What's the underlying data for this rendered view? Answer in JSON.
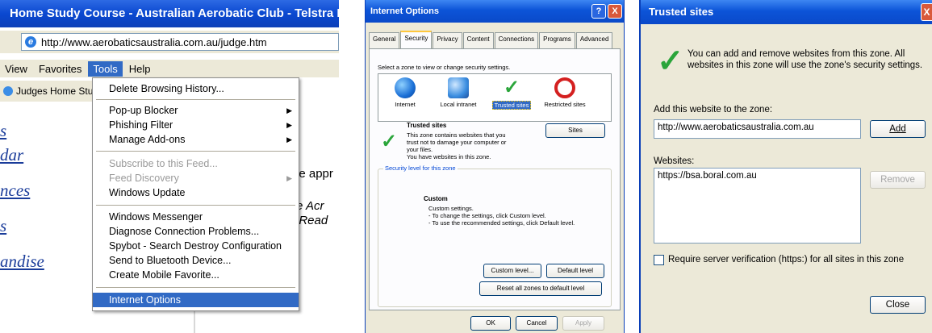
{
  "browser": {
    "title": "Home Study Course - Australian Aerobatic Club - Telstra BigP",
    "address": "http://www.aerobaticsaustralia.com.au/judge.htm",
    "menubar": [
      "View",
      "Favorites",
      "Tools",
      "Help"
    ],
    "active_menu": "Tools",
    "links_bar_item": "Judges Home Stu",
    "page_links": [
      "s",
      "dar",
      "nces",
      "s",
      "andise"
    ],
    "page_text": [
      "he appr",
      "re Acr",
      "f Read"
    ]
  },
  "tools_menu": {
    "items": [
      {
        "label": "Delete Browsing History...",
        "disabled": false,
        "submenu": false
      },
      {
        "label": "Pop-up Blocker",
        "disabled": false,
        "submenu": true
      },
      {
        "label": "Phishing Filter",
        "disabled": false,
        "submenu": true
      },
      {
        "label": "Manage Add-ons",
        "disabled": false,
        "submenu": true
      },
      {
        "label": "Subscribe to this Feed...",
        "disabled": true,
        "submenu": false
      },
      {
        "label": "Feed Discovery",
        "disabled": true,
        "submenu": true
      },
      {
        "label": "Windows Update",
        "disabled": false,
        "submenu": false
      },
      {
        "label": "Windows Messenger",
        "disabled": false,
        "submenu": false
      },
      {
        "label": "Diagnose Connection Problems...",
        "disabled": false,
        "submenu": false
      },
      {
        "label": "Spybot - Search  Destroy Configuration",
        "disabled": false,
        "submenu": false
      },
      {
        "label": "Send to Bluetooth Device...",
        "disabled": false,
        "submenu": false
      },
      {
        "label": "Create Mobile Favorite...",
        "disabled": false,
        "submenu": false
      },
      {
        "label": "Internet Options",
        "disabled": false,
        "submenu": false,
        "selected": true
      }
    ]
  },
  "internet_options": {
    "title": "Internet Options",
    "help_glyph": "?",
    "close_glyph": "X",
    "tabs": [
      "General",
      "Security",
      "Privacy",
      "Content",
      "Connections",
      "Programs",
      "Advanced"
    ],
    "active_tab": "Security",
    "zone_prompt": "Select a zone to view or change security settings.",
    "zones": [
      "Internet",
      "Local intranet",
      "Trusted sites",
      "Restricted sites"
    ],
    "selected_zone": "Trusted sites",
    "zone_title": "Trusted sites",
    "zone_desc": [
      "This zone contains websites that you",
      "trust not to damage your computer or",
      "your files.",
      "You have websites in this zone."
    ],
    "sites_button": "Sites",
    "security_group": "Security level for this zone",
    "level_title": "Custom",
    "level_desc": [
      "Custom settings.",
      "- To change the settings, click Custom level.",
      "- To use the recommended settings, click Default level."
    ],
    "custom_level_button": "Custom level...",
    "default_level_button": "Default level",
    "reset_button": "Reset all zones to default level",
    "ok_button": "OK",
    "cancel_button": "Cancel",
    "apply_button": "Apply"
  },
  "trusted_sites": {
    "title": "Trusted sites",
    "close_glyph": "X",
    "intro": "You can add and remove websites from this zone. All websites in this zone will use the zone's security settings.",
    "add_label": "Add this website to the zone:",
    "add_value": "http://www.aerobaticsaustralia.com.au",
    "add_button": "Add",
    "websites_label": "Websites:",
    "websites": [
      "https://bsa.boral.com.au"
    ],
    "remove_button": "Remove",
    "require_https_label": "Require server verification (https:) for all sites in this zone",
    "require_https_checked": false,
    "close_button": "Close"
  }
}
